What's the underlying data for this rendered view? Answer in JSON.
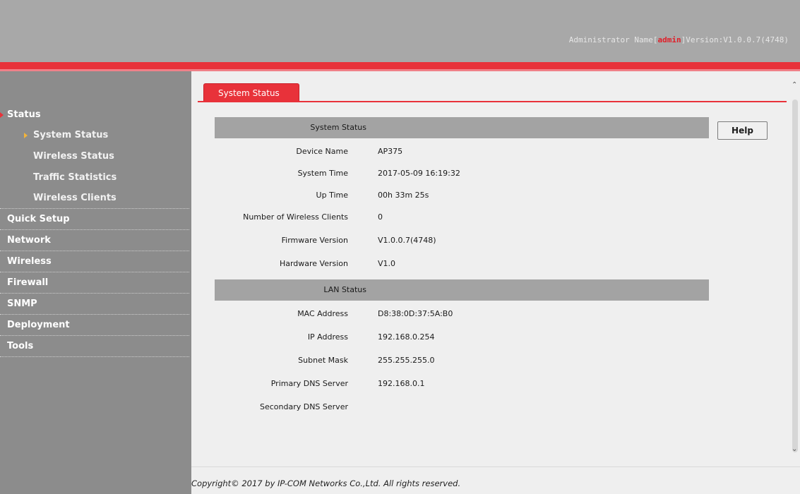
{
  "header": {
    "admin_prefix": "Administrator Name[",
    "admin_name": "admin",
    "version_text": "]Version:V1.0.0.7(4748)"
  },
  "sidebar": {
    "items": [
      {
        "label": "Status"
      },
      {
        "label": "System Status"
      },
      {
        "label": "Wireless Status"
      },
      {
        "label": "Traffic Statistics"
      },
      {
        "label": "Wireless Clients"
      },
      {
        "label": "Quick Setup"
      },
      {
        "label": "Network"
      },
      {
        "label": "Wireless"
      },
      {
        "label": "Firewall"
      },
      {
        "label": "SNMP"
      },
      {
        "label": "Deployment"
      },
      {
        "label": "Tools"
      }
    ]
  },
  "tab": {
    "label": "System Status"
  },
  "help": {
    "label": "Help"
  },
  "system_status": {
    "header": "System Status",
    "rows": [
      {
        "label": "Device Name",
        "value": "AP375"
      },
      {
        "label": "System Time",
        "value": "2017-05-09 16:19:32"
      },
      {
        "label": "Up Time",
        "value": "00h 33m 25s"
      },
      {
        "label": "Number of Wireless Clients",
        "value": "0"
      },
      {
        "label": "Firmware Version",
        "value": "V1.0.0.7(4748)"
      },
      {
        "label": "Hardware Version",
        "value": "V1.0"
      }
    ]
  },
  "lan_status": {
    "header": "LAN Status",
    "rows": [
      {
        "label": "MAC Address",
        "value": "D8:38:0D:37:5A:B0"
      },
      {
        "label": "IP Address",
        "value": "192.168.0.254"
      },
      {
        "label": "Subnet Mask",
        "value": "255.255.255.0"
      },
      {
        "label": "Primary DNS Server",
        "value": "192.168.0.1"
      },
      {
        "label": "Secondary DNS Server",
        "value": ""
      }
    ]
  },
  "footer": {
    "copyright": "Copyright© 2017 by IP-COM Networks Co.,Ltd. All rights reserved."
  },
  "colors": {
    "accent_red": "#e8323a",
    "sidebar_gray": "#8c8c8c",
    "header_gray": "#a8a8a8",
    "arrow_orange": "#f3b43a"
  },
  "icons": [
    "caret-right-icon",
    "scroll-up-icon",
    "scroll-down-icon"
  ]
}
